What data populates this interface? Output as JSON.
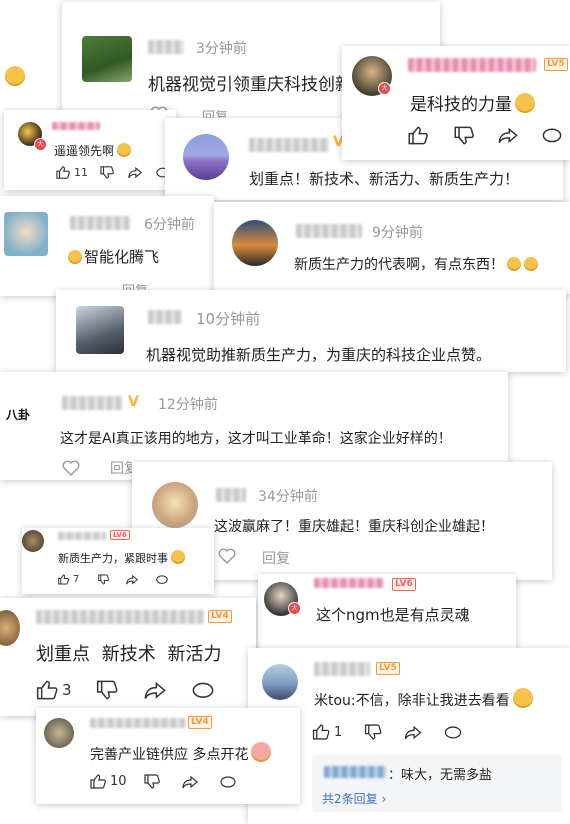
{
  "comments": [
    {
      "id": "c1",
      "time": "3分钟前",
      "text": "机器视觉引领重庆科技创新",
      "reply": "回复"
    },
    {
      "id": "c2",
      "level": "LV5",
      "text": "是科技的力量"
    },
    {
      "id": "c3",
      "text": "遥遥领先啊",
      "like_count": "11"
    },
    {
      "id": "c4",
      "text": "划重点！新技术、新活力、新质生产力！"
    },
    {
      "id": "c5",
      "time": "6分钟前",
      "text": "智能化腾飞",
      "reply": "回复"
    },
    {
      "id": "c6",
      "time": "9分钟前",
      "text": "新质生产力的代表啊，有点东西！"
    },
    {
      "id": "c7",
      "time": "10分钟前",
      "text": "机器视觉助推新质生产力，为重庆的科技企业点赞。"
    },
    {
      "id": "c8",
      "avatar_text": "八卦",
      "time": "12分钟前",
      "text": "这才是AI真正该用的地方，这才叫工业革命！这家企业好样的！",
      "reply": "回复"
    },
    {
      "id": "c9",
      "time": "34分钟前",
      "text": "这波赢麻了！重庆雄起！重庆科创企业雄起！",
      "reply": "回复"
    },
    {
      "id": "c10",
      "level": "LV6",
      "text": "新质生产力，紧跟时事",
      "like_count": "7"
    },
    {
      "id": "c11",
      "level": "LV6",
      "text": "这个ngm也是有点灵魂"
    },
    {
      "id": "c12",
      "level": "LV4",
      "text": "划重点 新技术 新活力",
      "like_count": "3"
    },
    {
      "id": "c13",
      "level": "LV5",
      "text": "米tou:不信，除非让我进去看看",
      "like_count": "1",
      "sub_reply": "：味大，无需多盐",
      "sub_count": "共2条回复 ›"
    },
    {
      "id": "c14",
      "level": "LV4",
      "text": "完善产业链供应 多点开花",
      "like_count": "10"
    }
  ],
  "colors": {
    "level_orange": "#f29a3b",
    "level_red": "#f0645a",
    "link_blue": "#3b70c4",
    "emoji_yellow": "#f5c34a"
  }
}
